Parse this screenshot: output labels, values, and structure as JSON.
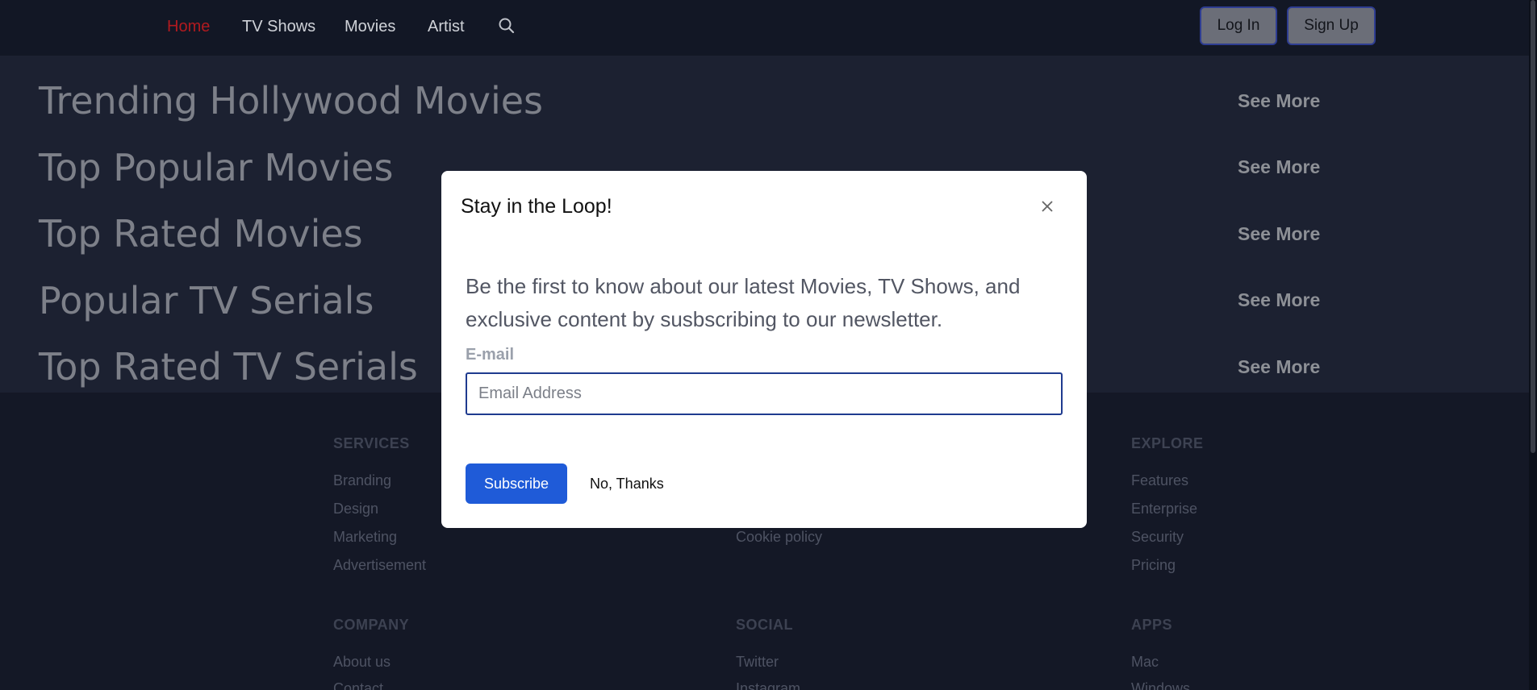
{
  "nav": {
    "items": [
      {
        "label": "Home",
        "active": true
      },
      {
        "label": "TV Shows"
      },
      {
        "label": "Movies"
      },
      {
        "label": "Artist"
      }
    ],
    "search_icon": "search-icon",
    "login_label": "Log In",
    "signup_label": "Sign Up"
  },
  "sections": [
    {
      "title": "Trending Hollywood Movies",
      "link": "See More"
    },
    {
      "title": "Top Popular Movies",
      "link": "See More"
    },
    {
      "title": "Top Rated Movies",
      "link": "See More"
    },
    {
      "title": "Popular TV Serials",
      "link": "See More"
    },
    {
      "title": "Top Rated TV Serials",
      "link": "See More"
    }
  ],
  "footer": {
    "services": {
      "heading": "SERVICES",
      "links": [
        "Branding",
        "Design",
        "Marketing",
        "Advertisement"
      ]
    },
    "legal": {
      "links": [
        "Cookie policy"
      ]
    },
    "explore": {
      "heading": "EXPLORE",
      "links": [
        "Features",
        "Enterprise",
        "Security",
        "Pricing"
      ]
    },
    "company": {
      "heading": "COMPANY",
      "links": [
        "About us",
        "Contact"
      ]
    },
    "social": {
      "heading": "SOCIAL",
      "links": [
        "Twitter",
        "Instagram"
      ]
    },
    "apps": {
      "heading": "APPS",
      "links": [
        "Mac",
        "Windows"
      ]
    }
  },
  "modal": {
    "title": "Stay in the Loop!",
    "close_icon": "close-icon",
    "text": "Be the first to know about our latest Movies, TV Shows, and exclusive content by susbscribing to our newsletter.",
    "email_label": "E-mail",
    "email_placeholder": "Email Address",
    "email_value": "",
    "subscribe_label": "Subscribe",
    "no_thanks_label": "No, Thanks"
  },
  "colors": {
    "nav_active": "#b11a1f",
    "primary_button": "#1f5bd8",
    "input_border": "#1f3b8f"
  }
}
